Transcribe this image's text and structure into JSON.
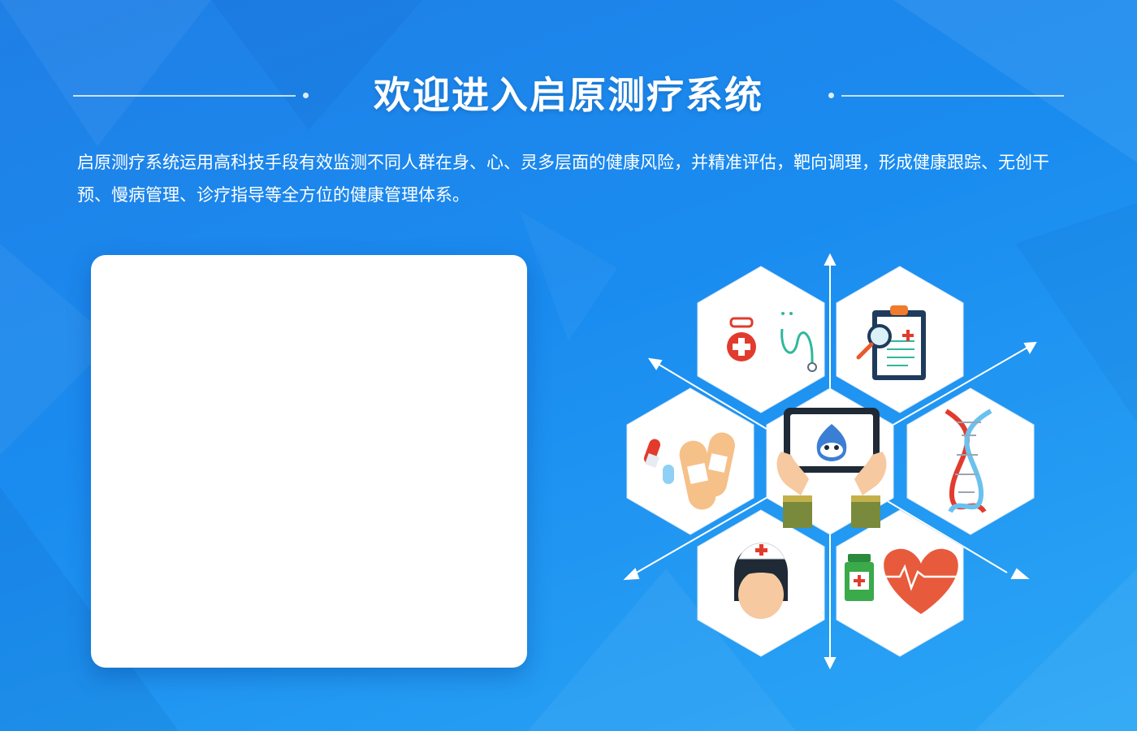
{
  "header": {
    "title": "欢迎进入启原测疗系统"
  },
  "intro": {
    "text": "启原测疗系统运用高科技手段有效监测不同人群在身、心、灵多层面的健康风险，并精准评估，靶向调理，形成健康跟踪、无创干预、慢病管理、诊疗指导等全方位的健康管理体系。"
  },
  "illustration": {
    "icons": [
      "medical-kit-stethoscope-icon",
      "clipboard-magnifier-icon",
      "pills-bandage-icon",
      "tablet-mascot-icon",
      "dna-icon",
      "nurse-icon",
      "medicine-heartbeat-icon"
    ]
  },
  "colors": {
    "background_start": "#1f7fe6",
    "background_end": "#2aa6f5",
    "panel": "#ffffff",
    "accent_red": "#e23b2e"
  }
}
